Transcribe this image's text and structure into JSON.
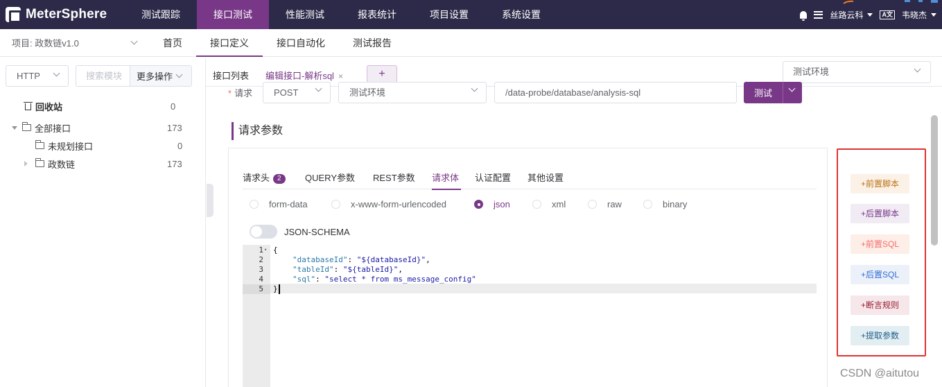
{
  "app": {
    "name": "MeterSphere",
    "logo_icon": "metersphere-logo-icon"
  },
  "top_nav": {
    "items": [
      "测试跟踪",
      "接口测试",
      "性能测试",
      "报表统计",
      "项目设置",
      "系统设置"
    ],
    "active_index": 1,
    "workspace": "丝路云科",
    "language_badge": "A文",
    "user": "韦晓杰",
    "bg_color": "#2c2a48",
    "accent_color": "#783887"
  },
  "sub_nav": {
    "project": "项目: 政数链v1.0",
    "items": [
      "首页",
      "接口定义",
      "接口自动化",
      "测试报告"
    ],
    "active_index": 1
  },
  "sidebar": {
    "protocol": "HTTP",
    "search_placeholder": "搜索模块",
    "more_ops": "更多操作",
    "tree": [
      {
        "label": "回收站",
        "count": "0",
        "icon": "trash-icon"
      },
      {
        "label": "全部接口",
        "count": "173",
        "icon": "folder-icon",
        "expanded": true
      },
      {
        "label": "未规划接口",
        "count": "0",
        "icon": "folder-icon"
      },
      {
        "label": "政数链",
        "count": "173",
        "icon": "folder-icon",
        "expanded": false
      }
    ]
  },
  "tabs": {
    "list": "接口列表",
    "editing": "编辑接口-解析sql",
    "close": "×",
    "add": "+",
    "env_placeholder": "测试环境"
  },
  "request": {
    "label": "请求",
    "method": "POST",
    "env": "测试环境",
    "url": "/data-probe/database/analysis-sql",
    "test_button": "测试"
  },
  "params": {
    "title": "请求参数",
    "tabs": [
      "请求头",
      "QUERY参数",
      "REST参数",
      "请求体",
      "认证配置",
      "其他设置"
    ],
    "header_count": "2",
    "active_tab": "请求体",
    "body_types": [
      "form-data",
      "x-www-form-urlencoded",
      "json",
      "xml",
      "raw",
      "binary"
    ],
    "selected_body_type": "json",
    "json_schema_label": "JSON-SCHEMA",
    "json_schema_on": false
  },
  "editor": {
    "line_numbers": [
      "1",
      "2",
      "3",
      "4",
      "5"
    ],
    "lines": [
      {
        "text": "{"
      },
      {
        "key": "\"databaseId\"",
        "sep": ": ",
        "val": "\"${databaseId}\"",
        "end": ","
      },
      {
        "key": "\"tableId\"",
        "sep": ": ",
        "val": "\"${tableId}\"",
        "end": ","
      },
      {
        "key": "\"sql\"",
        "sep": ": ",
        "val": "\"select * from ms_message_config\"",
        "end": ""
      },
      {
        "text": "}"
      }
    ]
  },
  "side_buttons": [
    {
      "label": "+前置脚本",
      "color": "#b8741a",
      "bg": "#fcf1e6"
    },
    {
      "label": "+后置脚本",
      "color": "#783887",
      "bg": "#f1ebf4"
    },
    {
      "label": "+前置SQL",
      "color": "#f56c6c",
      "bg": "#fdeee8"
    },
    {
      "label": "+后置SQL",
      "color": "#2f6fd6",
      "bg": "#ecf0f9"
    },
    {
      "label": "+断言规则",
      "color": "#9b1b30",
      "bg": "#f5e7ea"
    },
    {
      "label": "+提取参数",
      "color": "#1f5f8a",
      "bg": "#e3eef2"
    }
  ],
  "watermark": "CSDN @aitutou"
}
